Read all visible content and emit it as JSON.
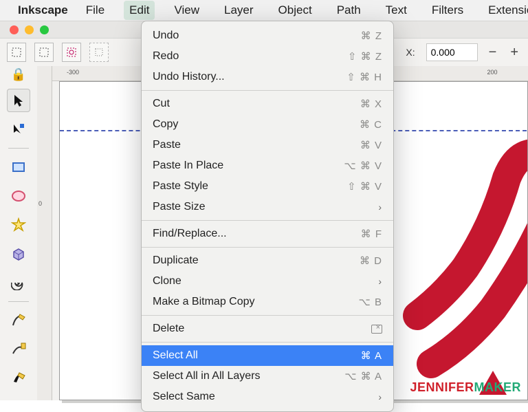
{
  "menubar": {
    "app": "Inkscape",
    "items": [
      "File",
      "Edit",
      "View",
      "Layer",
      "Object",
      "Path",
      "Text",
      "Filters",
      "Extension"
    ]
  },
  "toolrow": {
    "x_label": "X:",
    "x_value": "0.000"
  },
  "ruler": {
    "h": [
      "-300",
      "200"
    ],
    "v": [
      "0"
    ]
  },
  "edit_menu": [
    {
      "label": "Undo",
      "sc": "⌘ Z"
    },
    {
      "label": "Redo",
      "sc": "⇧ ⌘ Z"
    },
    {
      "label": "Undo History...",
      "sc": "⇧ ⌘ H"
    },
    {
      "sep": true
    },
    {
      "label": "Cut",
      "sc": "⌘ X"
    },
    {
      "label": "Copy",
      "sc": "⌘ C"
    },
    {
      "label": "Paste",
      "sc": "⌘ V"
    },
    {
      "label": "Paste In Place",
      "sc": "⌥ ⌘ V"
    },
    {
      "label": "Paste Style",
      "sc": "⇧ ⌘ V"
    },
    {
      "label": "Paste Size",
      "submenu": true
    },
    {
      "sep": true
    },
    {
      "label": "Find/Replace...",
      "sc": "⌘ F"
    },
    {
      "sep": true
    },
    {
      "label": "Duplicate",
      "sc": "⌘ D"
    },
    {
      "label": "Clone",
      "submenu": true
    },
    {
      "label": "Make a Bitmap Copy",
      "sc": "⌥ B"
    },
    {
      "sep": true
    },
    {
      "label": "Delete",
      "delicon": true
    },
    {
      "sep": true
    },
    {
      "label": "Select All",
      "sc": "⌘ A",
      "hl": true
    },
    {
      "label": "Select All in All Layers",
      "sc": "⌥ ⌘ A"
    },
    {
      "label": "Select Same",
      "submenu": true
    }
  ],
  "watermark": {
    "brand1": "JENNIFER",
    "brand2": "MAKER"
  }
}
